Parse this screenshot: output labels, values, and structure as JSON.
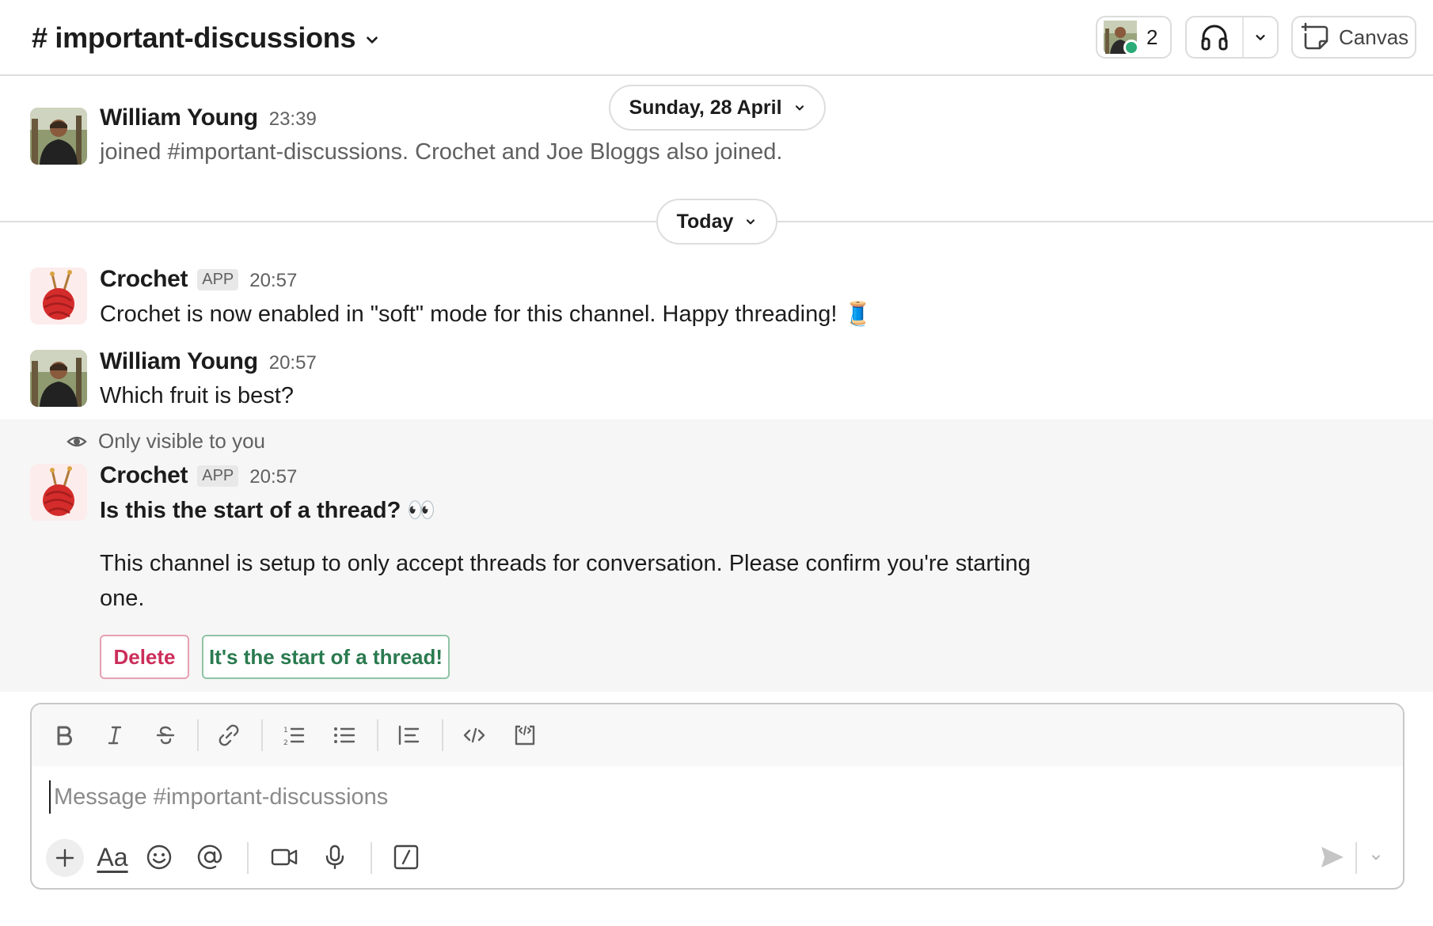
{
  "header": {
    "channel_name": "# important-discussions",
    "member_count": "2",
    "canvas_label": "Canvas"
  },
  "messages": [
    {
      "author": "William Young",
      "time": "23:39",
      "text": "joined #important-discussions. Crochet and Joe Bloggs also joined."
    },
    {
      "author": "Crochet",
      "badge": "APP",
      "time": "20:57",
      "text": "Crochet is now enabled in \"soft\" mode for this channel. Happy threading! 🧵"
    },
    {
      "author": "William Young",
      "time": "20:57",
      "text": "Which fruit is best?"
    }
  ],
  "date_dividers": {
    "first": "Sunday, 28 April",
    "second": "Today"
  },
  "ephemeral": {
    "visibility_note": "Only visible to you",
    "author": "Crochet",
    "badge": "APP",
    "time": "20:57",
    "heading": "Is this the start of a thread? 👀",
    "body_line1": "This channel is setup to only accept threads for conversation. Please confirm you're starting",
    "body_line2": "one.",
    "delete_label": "Delete",
    "confirm_label": "It's the start of a thread!"
  },
  "composer": {
    "placeholder": "Message #important-discussions",
    "value": "",
    "format_label": "Aa"
  },
  "colors": {
    "online": "#2bac76",
    "delete": "#cc2e5a",
    "confirm": "#2a7a4f"
  }
}
